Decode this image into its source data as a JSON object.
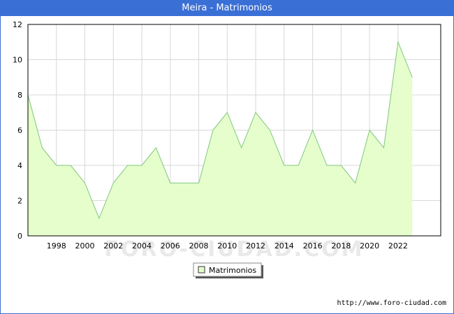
{
  "title": "Meira - Matrimonios",
  "footer_url": "http://www.foro-ciudad.com",
  "watermark": "FORO-CIUDAD.COM",
  "chart_data": {
    "type": "area",
    "x": [
      1996,
      1997,
      1998,
      1999,
      2000,
      2001,
      2002,
      2003,
      2004,
      2005,
      2006,
      2007,
      2008,
      2009,
      2010,
      2011,
      2012,
      2013,
      2014,
      2015,
      2016,
      2017,
      2018,
      2019,
      2020,
      2021,
      2022,
      2023
    ],
    "series": [
      {
        "name": "Matrimonios",
        "values": [
          8,
          5,
          4,
          4,
          3,
          1,
          3,
          4,
          4,
          5,
          3,
          3,
          3,
          6,
          7,
          5,
          7,
          6,
          4,
          4,
          6,
          4,
          4,
          3,
          6,
          5,
          11,
          9
        ],
        "line_color": "#7ec87e",
        "fill_color": "#e6fdcc"
      }
    ],
    "x_ticks": [
      1998,
      2000,
      2002,
      2004,
      2006,
      2008,
      2010,
      2012,
      2014,
      2016,
      2018,
      2020,
      2022
    ],
    "y_ticks": [
      0,
      2,
      4,
      6,
      8,
      10,
      12
    ],
    "xlim": [
      1996,
      2025
    ],
    "ylim": [
      0,
      12
    ],
    "grid": true,
    "legend_position": "bottom-center"
  }
}
